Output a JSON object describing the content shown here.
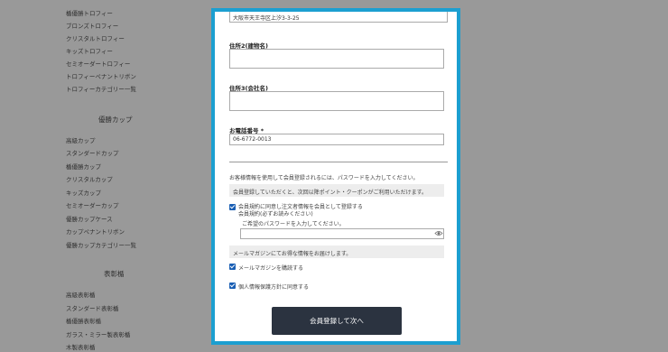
{
  "background": {
    "menu_items_top": [
      "楯優勝トロフィー",
      "ブロンズトロフィー",
      "クリスタルトロフィー",
      "キッズトロフィー",
      "セミオーダートロフィー",
      "トロフィーペナントリボン",
      "トロフィーカテゴリー一覧"
    ],
    "section_cup": "優勝カップ",
    "menu_items_cup": [
      "高級カップ",
      "スタンダードカップ",
      "楯優勝カップ",
      "クリスタルカップ",
      "キッズカップ",
      "セミオーダーカップ",
      "優勝カップケース",
      "カップペナントリボン",
      "優勝カップカテゴリー一覧"
    ],
    "section_plaque": "表彰楯",
    "menu_items_plaque": [
      "高級表彰楯",
      "スタンダード表彰楯",
      "楯優勝表彰楯",
      "ガラス・ミラー製表彰楯",
      "木製表彰楯"
    ]
  },
  "form": {
    "address1_value": "大阪市天王寺区上汐3-3-25",
    "address2_label": "住所2(建物名)",
    "address2_value": "",
    "address3_label": "住所3(会社名)",
    "address3_value": "",
    "phone_label": "お電話番号 *",
    "phone_value": "06-6772-0013",
    "register_note": "お客様情報を使用して会員登録されるには、パスワードを入力してください。",
    "member_benefit": "会員登録していただくと、次回以降ポイント・クーポンがご利用いただけます。",
    "agree_member_line1": "会員規約に同意し注文者情報を会員として登録する",
    "agree_member_line2": "会員規約(必ずお読みください)",
    "password_prompt": "ご希望のパスワードを入力してください。",
    "password_value": "",
    "newsletter_note": "メールマガジンにてお得な情報をお届けします。",
    "newsletter_label": "メールマガジンを購読する",
    "privacy_label": "個人情報保護方針に同意する",
    "submit_label": "会員登録して次へ"
  },
  "colors": {
    "accent": "#1c9fd0",
    "button": "#2b3340",
    "checkbox": "#1a5fb4"
  },
  "icons": {
    "password_toggle": "eye-icon"
  }
}
